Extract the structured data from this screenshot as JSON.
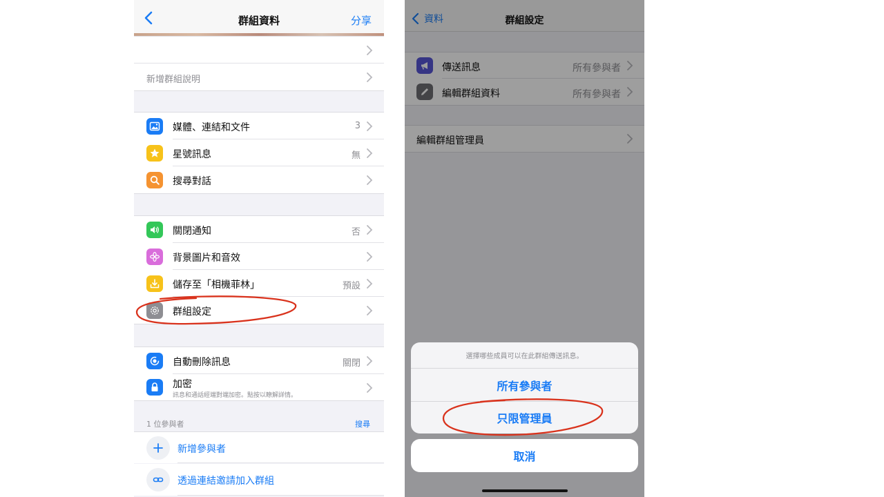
{
  "left": {
    "nav": {
      "title": "群組資料",
      "action": "分享"
    },
    "desc_row": {
      "label": "新增群組說明"
    },
    "media_group": [
      {
        "label": "媒體、連結和文件",
        "value": "3",
        "icon": "photo-icon",
        "color": "#1a7cf5"
      },
      {
        "label": "星號訊息",
        "value": "無",
        "icon": "star-icon",
        "color": "#f7c21a"
      },
      {
        "label": "搜尋對話",
        "value": "",
        "icon": "search-icon",
        "color": "#f59331"
      }
    ],
    "settings_group": [
      {
        "label": "關閉通知",
        "value": "否",
        "icon": "speaker-icon",
        "color": "#33c759"
      },
      {
        "label": "背景圖片和音效",
        "value": "",
        "icon": "flower-icon",
        "color": "#d96ddb"
      },
      {
        "label": "儲存至「相機菲林」",
        "value": "預設",
        "icon": "download-icon",
        "color": "#f7c21a"
      },
      {
        "label": "群組設定",
        "value": "",
        "icon": "gear-icon",
        "color": "#8e8e93"
      }
    ],
    "privacy_group": [
      {
        "label": "自動刪除訊息",
        "value": "關閉",
        "icon": "timer-icon",
        "color": "#1a7cf5"
      },
      {
        "label": "加密",
        "sublabel": "訊息和通話經端對端加密。點按以瞭解詳情。",
        "icon": "lock-icon",
        "color": "#1a7cf5"
      }
    ],
    "participants": {
      "count_label": "1 位參與者",
      "search_label": "搜尋",
      "add_label": "新增參與者",
      "invite_label": "透過連結邀請加入群組"
    }
  },
  "right": {
    "nav": {
      "back_label": "資料",
      "title": "群組設定"
    },
    "rows": [
      {
        "label": "傳送訊息",
        "value": "所有參與者",
        "icon": "megaphone-icon",
        "color": "#5856d6"
      },
      {
        "label": "編輯群組資料",
        "value": "所有參與者",
        "icon": "pencil-icon",
        "color": "#6e6e73"
      }
    ],
    "admins_label": "編輯群組管理員",
    "sheet": {
      "message": "選擇哪些成員可以在此群組傳送訊息。",
      "option_all": "所有參與者",
      "option_admins": "只限管理員",
      "cancel": "取消"
    }
  },
  "colors": {
    "accent": "#1a7cf5",
    "annotation": "#d9321c"
  }
}
